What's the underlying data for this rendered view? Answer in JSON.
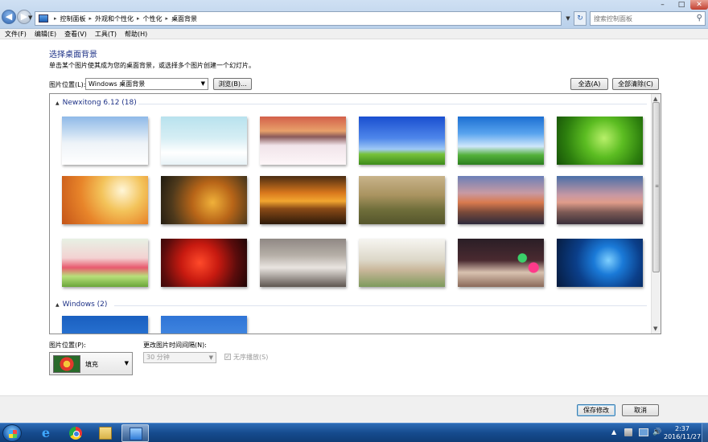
{
  "address": {
    "crumbs": [
      "控制面板",
      "外观和个性化",
      "个性化",
      "桌面背景"
    ],
    "search_placeholder": "搜索控制面板"
  },
  "menu": [
    "文件(F)",
    "编辑(E)",
    "查看(V)",
    "工具(T)",
    "帮助(H)"
  ],
  "page": {
    "title": "选择桌面背景",
    "subtitle": "单击某个图片使其成为您的桌面背景，或选择多个图片创建一个幻灯片。"
  },
  "location": {
    "label": "图片位置(L):",
    "value": "Windows 桌面背景",
    "browse": "浏览(B)...",
    "select_all": "全选(A)",
    "clear_all": "全部清除(C)"
  },
  "groups": [
    {
      "title": "Newxitong 6.12 (18)",
      "thumbs": [
        {
          "name": "snowy-road",
          "bg": "linear-gradient(180deg,#8fb9e8 0%,#c9def2 35%,#eef3f8 55%,#ffffff 100%)"
        },
        {
          "name": "snow-trees",
          "bg": "linear-gradient(180deg,#b8e2ee 0%,#d6eef4 45%,#ffffff 75%,#e8f3f7 100%)"
        },
        {
          "name": "snow-cabin-sunset",
          "bg": "linear-gradient(180deg,#d3604a 0%,#e8a06a 30%,#8a5a5a 42%,#f1e4ea 60%,#fdf6f8 100%)"
        },
        {
          "name": "blue-sky-green-field",
          "bg": "linear-gradient(180deg,#1a4fd0 0%,#4e86ea 45%,#9fc9f5 68%,#77c23a 78%,#3d8c1a 100%)"
        },
        {
          "name": "clouds-meadow",
          "bg": "linear-gradient(180deg,#1c6fd2 0%,#58a3ee 35%,#cfe7fb 62%,#53b13a 80%,#2b7f1e 100%)"
        },
        {
          "name": "green-leaves",
          "bg": "radial-gradient(circle at 55% 45%,#b8f06a 0%,#5cbd22 35%,#2d7f0e 70%,#175208 100%)"
        },
        {
          "name": "autumn-leaves-bokeh",
          "bg": "radial-gradient(circle at 70% 30%,#fff6d8 0%,#f3c35a 30%,#e8852a 60%,#c45418 100%)"
        },
        {
          "name": "autumn-leaf-closeup",
          "bg": "radial-gradient(circle at 60% 55%,#f0b13a 0%,#b86518 35%,#4f3a1c 70%,#1f1a10 100%)"
        },
        {
          "name": "autumn-lake-sunset",
          "bg": "linear-gradient(180deg,#4a2c12 0%,#d9781c 35%,#f2a630 52%,#8a4a16 68%,#2e1a0a 100%)"
        },
        {
          "name": "misty-forest",
          "bg": "linear-gradient(180deg,#c8b38a 0%,#a99360 40%,#6f6e3a 70%,#55552c 100%)"
        },
        {
          "name": "mountain-peak-sunrise",
          "bg": "linear-gradient(180deg,#6b7fb7 0%,#c79aa4 35%,#d97a4e 55%,#7a4a3a 75%,#2e2a3c 100%)"
        },
        {
          "name": "mountains-dusk",
          "bg": "linear-gradient(180deg,#4a6fa8 0%,#c898a3 40%,#e09c8a 55%,#7d5a55 75%,#3a2f3a 100%)"
        },
        {
          "name": "tulips",
          "bg": "linear-gradient(180deg,#e7f1e4 0%,#f3d2d2 40%,#e85a6e 60%,#b8e07a 78%,#6aa63a 100%)"
        },
        {
          "name": "red-maple",
          "bg": "radial-gradient(circle at 45% 50%,#ff4a2a 0%,#c81a10 35%,#5a0c0c 70%,#200505 100%)"
        },
        {
          "name": "girl-portrait-1",
          "bg": "linear-gradient(180deg,#8f8884 0%,#b7b0a8 35%,#e9e4e0 60%,#5e5650 100%)"
        },
        {
          "name": "girl-portrait-2",
          "bg": "linear-gradient(180deg,#f6f5f1 0%,#dcd7c8 45%,#c9b79a 65%,#7d9a5c 100%)"
        },
        {
          "name": "coffee-cup-lights",
          "bg": "radial-gradient(circle at 75% 40%,#3ad06a 0 6%,transparent 7%),radial-gradient(circle at 88% 60%,#ff3a8a 0 6%,transparent 7%),linear-gradient(180deg,#2a1e26 0%,#4a2a30 45%,#d9c2b0 70%,#8a6a5a 100%)"
        },
        {
          "name": "windows-10-logo",
          "bg": "radial-gradient(circle at 60% 45%,#7fd0ff 0%,#1a7ad8 25%,#0b3f8a 55%,#061a3c 100%)"
        }
      ]
    },
    {
      "title": "Windows (2)",
      "thumbs": [
        {
          "name": "windows-blue",
          "bg": "linear-gradient(180deg,#1a5fc0 0%,#2e7ad8 60%,#4a95e8 100%)"
        },
        {
          "name": "daisy-flower",
          "bg": "radial-gradient(circle at 40% 60%,#ffffff 0 14%,transparent 15%),linear-gradient(180deg,#2f74d6 0%,#5aa0ee 100%)"
        }
      ]
    }
  ],
  "position": {
    "label": "图片位置(P):",
    "value": "填充"
  },
  "interval": {
    "label": "更改图片时间间隔(N):",
    "value": "30 分钟"
  },
  "shuffle_label": "无序播放(S)",
  "footer": {
    "save": "保存修改",
    "cancel": "取消"
  },
  "clock": {
    "time": "2:37",
    "date": "2016/11/27"
  }
}
